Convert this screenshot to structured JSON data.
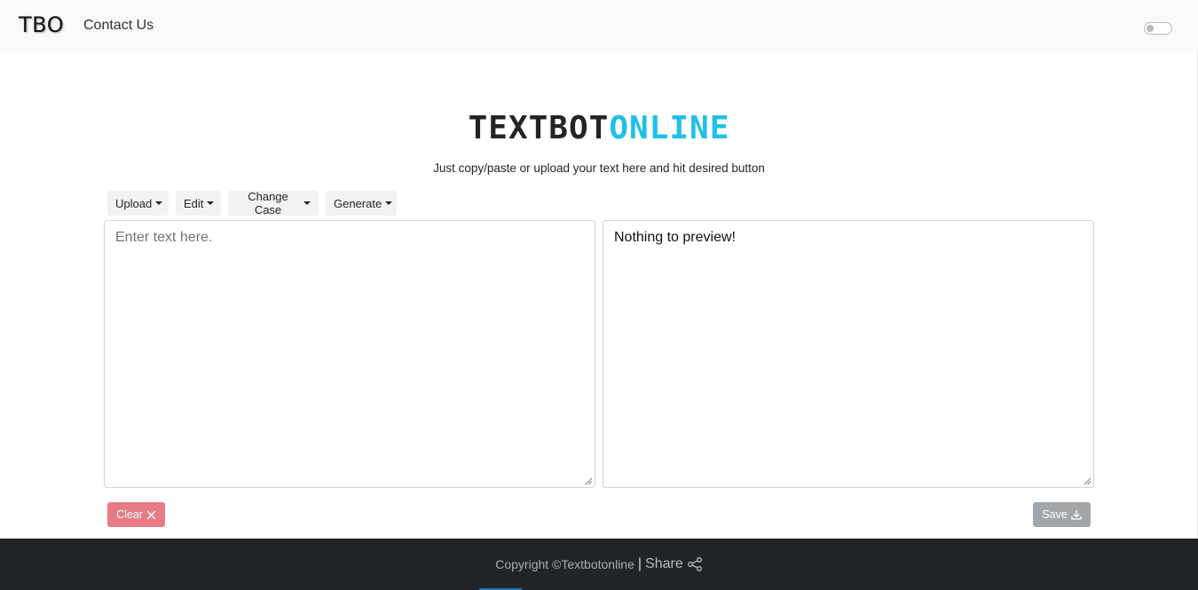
{
  "navbar": {
    "brand": "TBO",
    "links": [
      {
        "label": "Contact Us"
      }
    ],
    "theme_toggle": {
      "state": "off"
    }
  },
  "hero": {
    "title_part1": "TEXTBOT",
    "title_part2": "ONLINE",
    "subtitle": "Just copy/paste or upload your text here and hit desired button",
    "colors": {
      "title_dark": "#212529",
      "title_accent": "#1fc0e6"
    }
  },
  "toolbar": {
    "menus": [
      {
        "label": "Upload"
      },
      {
        "label": "Edit"
      },
      {
        "label": "Change Case"
      },
      {
        "label": "Generate"
      }
    ]
  },
  "editor": {
    "input": {
      "value": "",
      "placeholder": "Enter text here."
    },
    "preview": {
      "text": "Nothing to preview!"
    }
  },
  "actions": {
    "clear": {
      "label": "Clear",
      "icon": "x-icon",
      "color": "#e67b86"
    },
    "save": {
      "label": "Save",
      "icon": "download-icon",
      "color": "#a1a6ab"
    }
  },
  "footer": {
    "copyright": "Copyright ©Textbotonline",
    "separator": "|",
    "share_label": "Share",
    "share_icon": "share-icon"
  }
}
